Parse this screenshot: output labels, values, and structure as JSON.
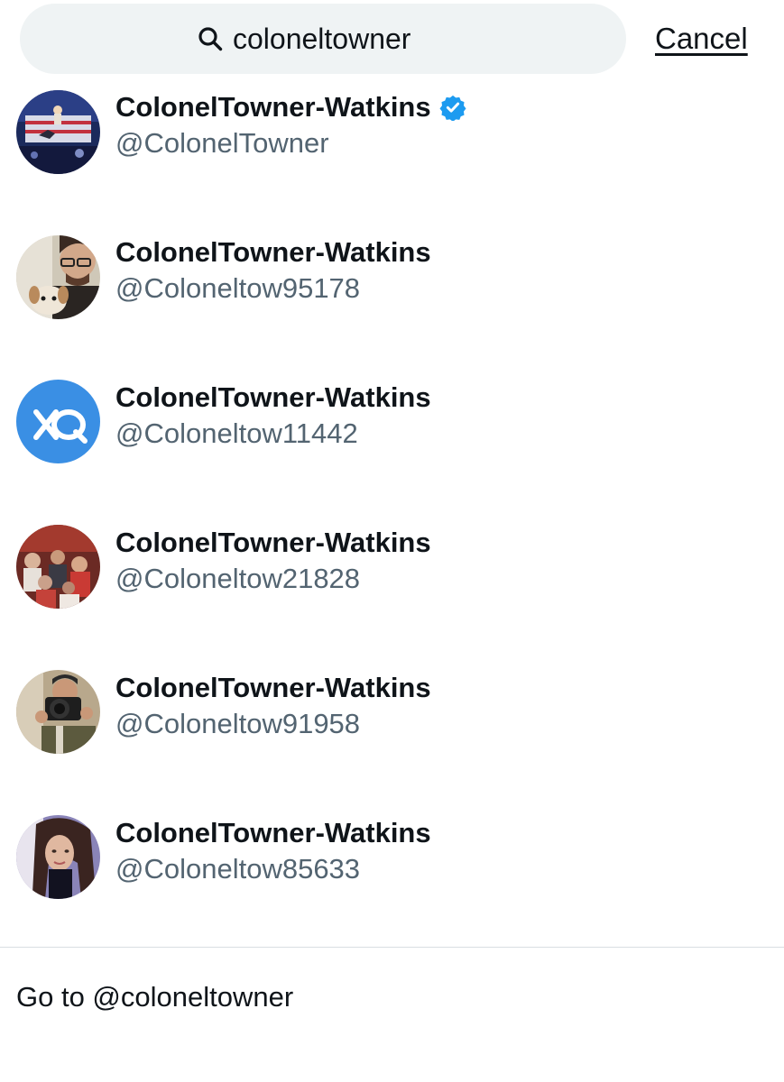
{
  "search": {
    "icon": "search-icon",
    "value": "coloneltowner"
  },
  "cancel_label": "Cancel",
  "results": [
    {
      "display_name": "ColonelTowner-Watkins",
      "handle": "@ColonelTowner",
      "verified": true,
      "verified_color": "#1d9bf0",
      "avatar": "rally-crowd-avatar"
    },
    {
      "display_name": "ColonelTowner-Watkins",
      "handle": "@Coloneltow95178",
      "verified": false,
      "avatar": "man-with-dog-avatar"
    },
    {
      "display_name": "ColonelTowner-Watkins",
      "handle": "@Coloneltow11442",
      "verified": false,
      "avatar": "blue-logo-avatar"
    },
    {
      "display_name": "ColonelTowner-Watkins",
      "handle": "@Coloneltow21828",
      "verified": false,
      "avatar": "crowd-avatar"
    },
    {
      "display_name": "ColonelTowner-Watkins",
      "handle": "@Coloneltow91958",
      "verified": false,
      "avatar": "photographer-avatar"
    },
    {
      "display_name": "ColonelTowner-Watkins",
      "handle": "@Coloneltow85633",
      "verified": false,
      "avatar": "woman-portrait-avatar"
    }
  ],
  "goto_label": "Go to @coloneltowner",
  "colors": {
    "search_bg": "#eff3f4",
    "secondary_text": "#536471",
    "primary_text": "#0f1419",
    "accent": "#1d9bf0"
  }
}
